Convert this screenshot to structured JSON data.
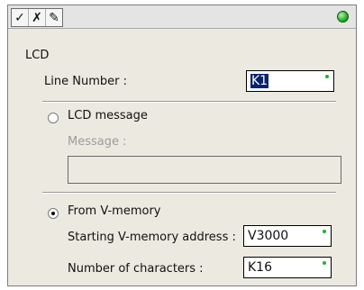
{
  "toolbar": {
    "buttons": [
      {
        "icon": "check-icon",
        "glyph": "✓"
      },
      {
        "icon": "cancel-icon",
        "glyph": "✗"
      },
      {
        "icon": "help-icon",
        "glyph": "✎"
      }
    ],
    "status_color": "#25b125"
  },
  "form": {
    "group_label": "LCD",
    "line_number_label": "Line Number :",
    "line_number_value": "K1",
    "option_lcd_message_label": "LCD message",
    "option_lcd_message_selected": false,
    "message_label": "Message :",
    "message_value": "",
    "option_vmemory_label": "From V-memory",
    "option_vmemory_selected": true,
    "start_address_label": "Starting V-memory address :",
    "start_address_value": "V3000",
    "num_chars_label": "Number of characters :",
    "num_chars_value": "K16"
  }
}
